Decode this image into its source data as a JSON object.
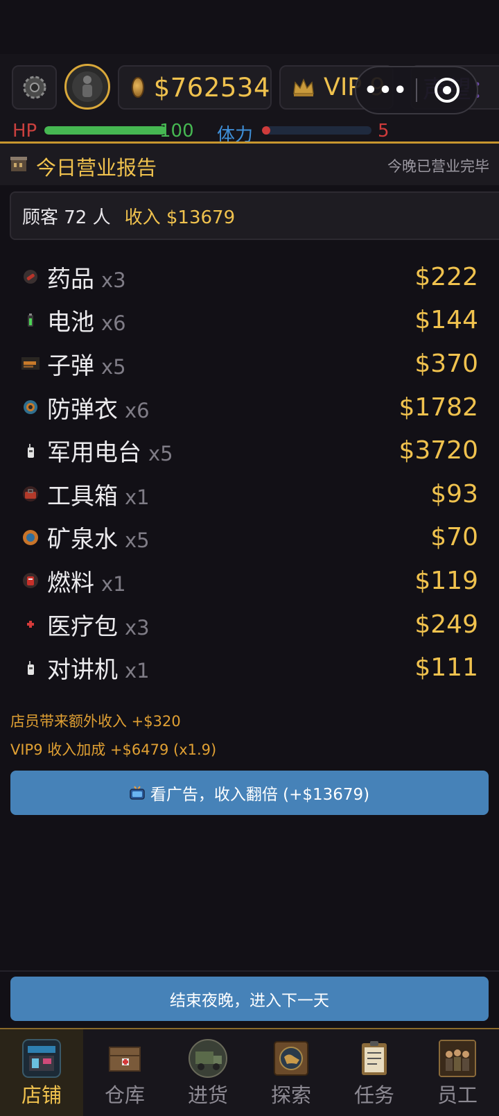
{
  "header": {
    "money": "$762534",
    "vip": "VIP 9",
    "reputation": "声望：",
    "hp_label": "HP",
    "hp_value": "100",
    "hp_fraction": 1.0,
    "stamina_label": "体力",
    "stamina_value": "5",
    "stamina_fraction": 0.05
  },
  "report": {
    "title": "今日营业报告",
    "status": "今晚已营业完毕",
    "customers": "顾客 72 人",
    "income": "收入 $13679"
  },
  "items": [
    {
      "name": "药品",
      "qty": "x3",
      "price": "$222",
      "icon": "medicine-icon"
    },
    {
      "name": "电池",
      "qty": "x6",
      "price": "$144",
      "icon": "battery-icon"
    },
    {
      "name": "子弹",
      "qty": "x5",
      "price": "$370",
      "icon": "bullet-icon"
    },
    {
      "name": "防弹衣",
      "qty": "x6",
      "price": "$1782",
      "icon": "vest-icon"
    },
    {
      "name": "军用电台",
      "qty": "x5",
      "price": "$3720",
      "icon": "radio-icon"
    },
    {
      "name": "工具箱",
      "qty": "x1",
      "price": "$93",
      "icon": "toolbox-icon"
    },
    {
      "name": "矿泉水",
      "qty": "x5",
      "price": "$70",
      "icon": "water-icon"
    },
    {
      "name": "燃料",
      "qty": "x1",
      "price": "$119",
      "icon": "fuel-icon"
    },
    {
      "name": "医疗包",
      "qty": "x3",
      "price": "$249",
      "icon": "medkit-icon"
    },
    {
      "name": "对讲机",
      "qty": "x1",
      "price": "$111",
      "icon": "walkie-talkie-icon"
    }
  ],
  "bonuses": {
    "staff": "店员带来额外收入 +$320",
    "vip": "VIP9 收入加成 +$6479 (x1.9)"
  },
  "buttons": {
    "watch_ad": "看广告，收入翻倍 (+$13679)",
    "end_night": "结束夜晚，进入下一天"
  },
  "nav": [
    {
      "label": "店铺",
      "active": true,
      "icon": "shop-icon"
    },
    {
      "label": "仓库",
      "active": false,
      "icon": "warehouse-icon"
    },
    {
      "label": "进货",
      "active": false,
      "icon": "truck-icon"
    },
    {
      "label": "探索",
      "active": false,
      "icon": "map-icon"
    },
    {
      "label": "任务",
      "active": false,
      "icon": "clipboard-icon"
    },
    {
      "label": "员工",
      "active": false,
      "icon": "staff-icon"
    }
  ],
  "colors": {
    "accent_gold": "#f0c24e",
    "button_blue": "#4682b8",
    "hp_green": "#46b852",
    "stamina_red": "#cf3b3b"
  }
}
